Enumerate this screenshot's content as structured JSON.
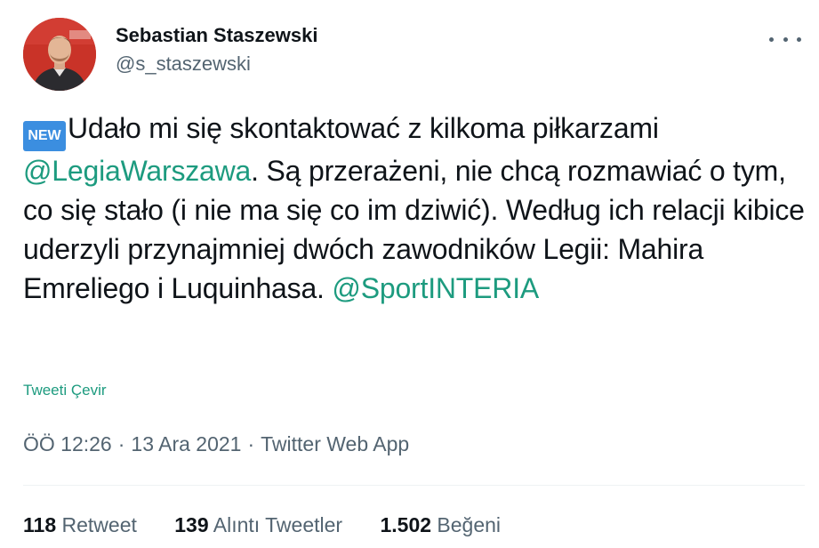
{
  "author": {
    "display_name": "Sebastian Staszewski",
    "handle": "@s_staszewski"
  },
  "more_icon": "ellipsis-icon",
  "tweet": {
    "badge": "NEW",
    "text_1": "Udało mi się skontaktować z kilkoma piłkarzami ",
    "mention_1": "@LegiaWarszawa",
    "text_2": ". Są przerażeni, nie chcą rozmawiać o tym, co się stało (i nie ma się co im dziwić). Według ich relacji kibice uderzyli przynajmniej dwóch zawodników Legii: Mahira Emreliego i Luquinhasa. ",
    "mention_2": "@SportINTERIA"
  },
  "translate_label": "Tweeti Çevir",
  "meta": {
    "time": "ÖÖ 12:26",
    "separator": "·",
    "date": "13 Ara 2021",
    "source": "Twitter Web App"
  },
  "stats": {
    "retweets_count": "118",
    "retweets_label": "Retweet",
    "quotes_count": "139",
    "quotes_label": "Alıntı Tweetler",
    "likes_count": "1.502",
    "likes_label": "Beğeni"
  },
  "colors": {
    "link": "#1d9b7f",
    "secondary_text": "#536471",
    "badge_bg": "#3b8ee0"
  }
}
